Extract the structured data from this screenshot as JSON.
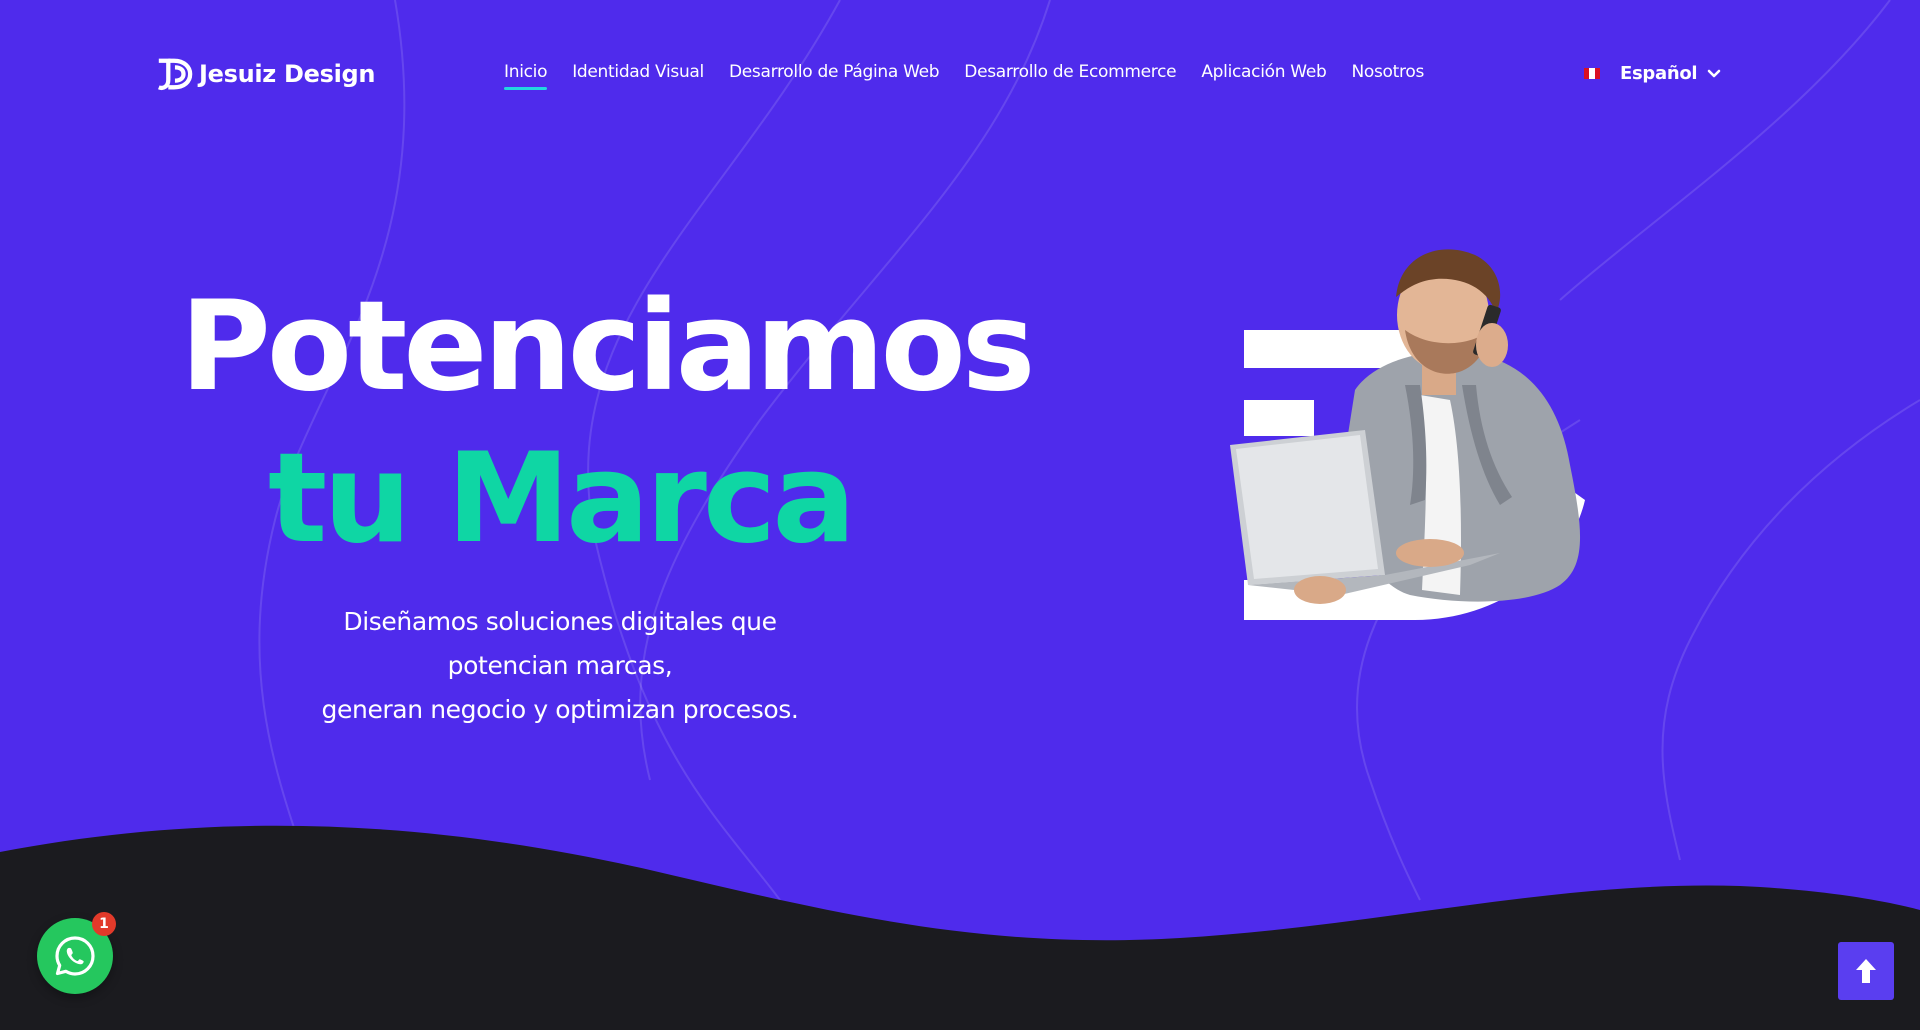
{
  "brand": {
    "name": "Jesuiz Design",
    "logo_icon": "jd-monogram-icon"
  },
  "nav": {
    "items": [
      {
        "label": "Inicio",
        "active": true
      },
      {
        "label": "Identidad Visual",
        "active": false
      },
      {
        "label": "Desarrollo de Página Web",
        "active": false
      },
      {
        "label": "Desarrollo de Ecommerce",
        "active": false
      },
      {
        "label": "Aplicación Web",
        "active": false
      },
      {
        "label": "Nosotros",
        "active": false
      }
    ]
  },
  "language": {
    "label": "Español",
    "flag_icon": "peru-flag-icon",
    "chevron_icon": "chevron-down-icon"
  },
  "hero": {
    "title_line1": "Potenciamos",
    "title_line2": "tu Marca",
    "subtitle_line1": "Diseñamos soluciones digitales que potencian marcas,",
    "subtitle_line2": "generan negocio y optimizan procesos.",
    "image": "man-with-laptop-on-phone-illustration"
  },
  "whatsapp": {
    "icon": "whatsapp-icon",
    "badge_count": "1"
  },
  "scroll_top": {
    "icon": "arrow-up-icon"
  },
  "colors": {
    "background": "#4f2bec",
    "accent_green": "#0fd6a4",
    "nav_underline": "#22d6e0",
    "footer_dark": "#1b1b1f",
    "whatsapp_green": "#25c75e",
    "badge_red": "#e23a2a"
  }
}
